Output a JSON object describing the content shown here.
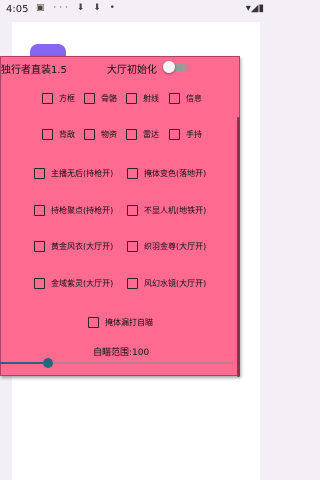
{
  "statusbar": {
    "time": "4:05",
    "icons_left": "▣ ··· ⬇ ⬇ •",
    "icons_right": "▾◢▮"
  },
  "panel": {
    "title": "独行者直装1.5",
    "lobby_init_label": "大厅初始化",
    "lobby_init_on": false,
    "row1": [
      "方框",
      "骨骼",
      "射线",
      "信息"
    ],
    "row2": [
      "背敌",
      "物资",
      "雷达",
      "手持"
    ],
    "options": [
      "主播无后(持枪开)",
      "掩体变色(落地开)",
      "持枪聚点(持枪开)",
      "不显人机(地铁开)",
      "黄金风衣(大厅开)",
      "织羽金尊(大厅开)",
      "金域紫灵(大厅开)",
      "风幻水镜(大厅开)"
    ],
    "cover_aim": "掩体漏打自瞄",
    "aim_range_label": "自瞄范围:100",
    "aim_range_value": 100
  },
  "colors": {
    "panel_bg": "#ff6a91",
    "accent_tab": "#8666f0",
    "slider": "#1b6b7d"
  }
}
